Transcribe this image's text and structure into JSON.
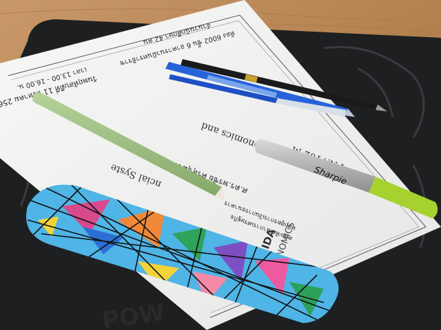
{
  "document": {
    "header_right": "วันพฤหัสบดีที่ 11 สิงหาคม 2565",
    "time": "เวลา 13.00 - 16.00 น.",
    "room": "ห้อง 6002 ชั้น 6 อาคารนวมินทราธิราช",
    "students": "จำนวนนักศึกษา 42 คน",
    "course_code": "FN.7102 M",
    "course_title_a": "Economics and",
    "course_title_b": "ncial Syste",
    "lecturer": "ศ.ดร.พรชัย ศรีสุขุมวัน",
    "school_line_1": "หลักสูตรการเงินการธนาคาร",
    "school_line_2": "คณะพัฒนาการเศรษฐกิจ",
    "logo_text": "NIDA",
    "logo_sub": "ECONOMICS"
  },
  "marker": {
    "brand": "Sharpie",
    "cap_color": "#a6d12e"
  },
  "mat": {
    "print": "POW"
  },
  "colors": {
    "table": "#b88a5c",
    "mat": "#1e1f21",
    "paper": "#f3f3f1",
    "pencil": "#9cbf7f",
    "pen_blue": "#1e5ed8",
    "case_base": "#4fb4e6"
  }
}
